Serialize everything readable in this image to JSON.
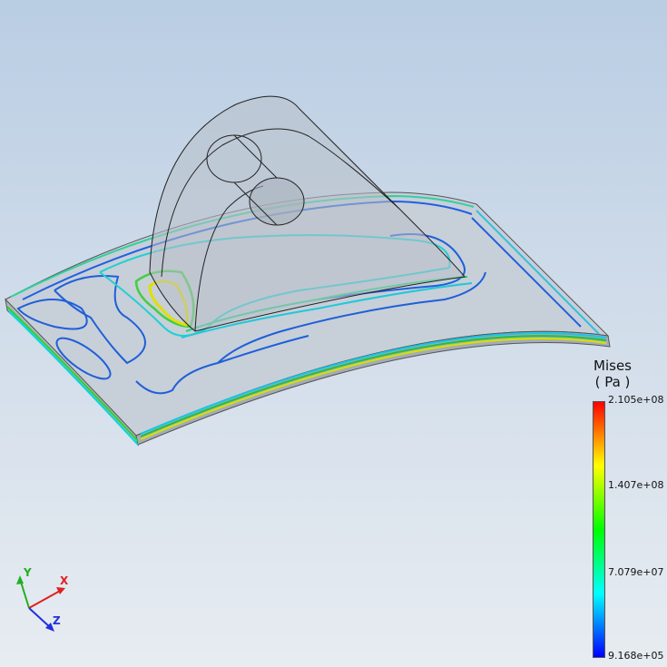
{
  "legend": {
    "title_line1": "Mises",
    "title_line2": "( Pa )",
    "ticks": [
      "2.105e+08",
      "1.407e+08",
      "7.079e+07",
      "9.168e+05"
    ],
    "gradient_colors": [
      "#ff0000",
      "#ffff00",
      "#00ff00",
      "#00ffff",
      "#0000ff"
    ]
  },
  "triad": {
    "x_label": "X",
    "y_label": "Y",
    "z_label": "Z"
  },
  "colors": {
    "x_axis": "#e02020",
    "y_axis": "#20b020",
    "z_axis": "#2030e0",
    "plate": "#c6ced9",
    "lug": "#b3bac3"
  }
}
